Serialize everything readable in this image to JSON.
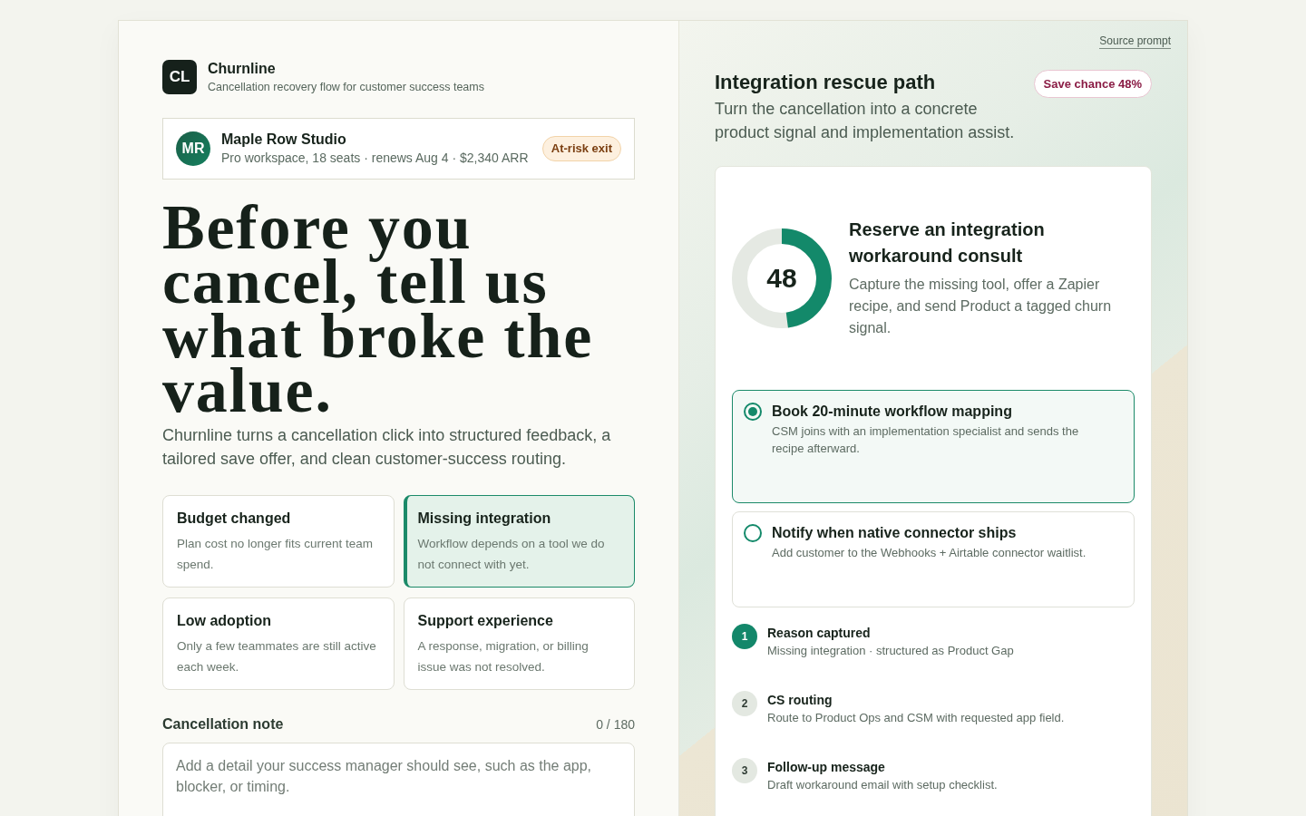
{
  "brand": {
    "logo": "CL",
    "name": "Churnline",
    "tagline": "Cancellation recovery flow for customer success teams"
  },
  "customer": {
    "initials": "MR",
    "name": "Maple Row Studio",
    "details": "Pro workspace, 18 seats · renews Aug 4 · $2,340 ARR",
    "badge": "At-risk exit"
  },
  "headline": "Before you cancel, tell us what broke the value.",
  "intro": "Churnline turns a cancellation click into structured feedback, a tailored save offer, and clean customer-success routing.",
  "reasons": [
    {
      "title": "Budget changed",
      "description": "Plan cost no longer fits current team spend.",
      "selected": false
    },
    {
      "title": "Missing integration",
      "description": "Workflow depends on a tool we do not connect with yet.",
      "selected": true
    },
    {
      "title": "Low adoption",
      "description": "Only a few teammates are still active each week.",
      "selected": false
    },
    {
      "title": "Support experience",
      "description": "A response, migration, or billing issue was not resolved.",
      "selected": false
    }
  ],
  "note": {
    "label": "Cancellation note",
    "counter": "0 / 180",
    "placeholder": "Add a detail your success manager should see, such as the app, blocker, or timing."
  },
  "source_link": "Source prompt",
  "rescue": {
    "title": "Integration rescue path",
    "subtitle": "Turn the cancellation into a concrete product signal and implementation assist.",
    "badge": "Save chance 48%"
  },
  "plan": {
    "score": "48",
    "level": 0.48,
    "title": "Reserve an integration workaround consult",
    "description": "Capture the missing tool, offer a Zapier recipe, and send Product a tagged churn signal."
  },
  "options": [
    {
      "title": "Book 20-minute workflow mapping",
      "description": "CSM joins with an implementation specialist and sends the recipe afterward.",
      "selected": true
    },
    {
      "title": "Notify when native connector ships",
      "description": "Add customer to the Webhooks + Airtable connector waitlist.",
      "selected": false
    }
  ],
  "steps": [
    {
      "number": "1",
      "title": "Reason captured",
      "description": "Missing integration · structured as Product Gap",
      "completed": true
    },
    {
      "number": "2",
      "title": "CS routing",
      "description": "Route to Product Ops and CSM with requested app field.",
      "completed": false
    },
    {
      "number": "3",
      "title": "Follow-up message",
      "description": "Draft workaround email with setup checklist.",
      "completed": false
    }
  ]
}
